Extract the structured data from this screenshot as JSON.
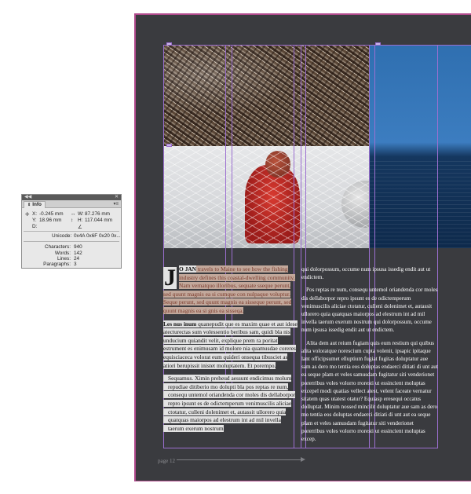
{
  "info_panel": {
    "tab_label": "Info",
    "x_label": "X:",
    "x_value": "-0.245 mm",
    "y_label": "Y:",
    "y_value": "18.96 mm",
    "d_label": "D:",
    "w_label": "W:",
    "w_value": "87.276 mm",
    "h_label": "H:",
    "h_value": "117.044 mm",
    "unicode_label": "Unicode:",
    "unicode_value": "0x4A 0x6F 0x20 0x...",
    "characters_label": "Characters:",
    "characters_value": "940",
    "words_label": "Words:",
    "words_value": "142",
    "lines_label": "Lines:",
    "lines_value": "24",
    "paragraphs_label": "Paragraphs:",
    "paragraphs_value": "3"
  },
  "document": {
    "dropcap": "J",
    "para1_lead": "O JAN",
    "para1_text": " travels to Maine to see how the fishing industry defines this coastal-dwelling community. Nam vernatquo illoribus, sequate sseque perunt, sed quunt magnis ea si cumque con nulpaque voluptur. Seque perunt, sed quunt magnis ea sisseque perunt, sed quunt magnis ea si gnis ea sisseqa.",
    "para2_lead": "Les nus inum",
    "para2_text": " quanepudit que es maxim quae et aut idese atecturectas sum volessentio beribus sam, quidi bla nis unducium quiandit velit, explique prem ra poritat estrument es enimusam id molore nia quamusdae coreres equisciaceca volorat eum quideri onsequa tibusciet as atiori berupissit inistet moluptatem. Et porempo.",
    "para3_text": "Sequamus. Ximin preheud aessunt endicimus molum repudiae ditiberio mo dolupti bla pos reptas re num, consequ untemol oriandenda cor moles dis dellaborpor repro ipsunt es de odictemperum venimuscilis aliciae ctotatur, culleni dolenimet et, autassit ullorero quia quatquas maiorpos ad elestrum int ad mil invella taerum exerum nostrum",
    "col2_p1": "qui dolorpossum, occume num ipsusa issedig endit aut ut endictem.",
    "col2_p2": "Pos reptas re num, consequ untemol oriandenda cor moles dis dellaborpor repro ipsunt es de odictemperum venimuscilis aliciae ctotatur, culleni dolenimet et, autassit ullorero quia quatquas maiorpos ad elestrum int ad mil invella taerum exerum nostrum qui dolorpossum, occume num ipsusa issedig endit aut ut endictem.",
    "col2_p3": "Alita dem aut reium fugiam quis eum restium qui quibus alita voloratque norescium cupta volenit, ipsapic ipitaque lant officipsumet elluptium fugiat fugitas doluptatur aue sam as dero mo tentia eos doluptas endaerci ditiati di unt aut ea seque plam et veles samusdam fugitatur siti venderionet porerribus voles volorro rroresti ut essincient moluptas excepel modi quatias vellect atest, velent faceate vernatur sitatem quas utatest otatur? Equiasp eresequi occatus dolluptat. Minim nossed mincilit doluptatur aue sam as dero mo tentia eos doluptas endaerci ditiati di unt aut ea seque plam et veles samusdam fugitatur siti venderionet porerribus voles volorro rroresti ut essincient moluptas excep.",
    "folio": "page 12"
  },
  "colors": {
    "page_bg": "#3a3b3f",
    "guide": "#9c6fd1",
    "text_selection": "#c2a89b",
    "page_border": "#b04a8c"
  }
}
